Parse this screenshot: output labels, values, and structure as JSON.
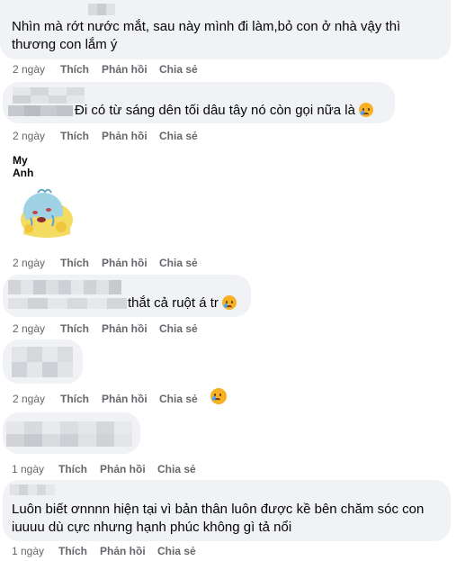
{
  "actions": {
    "time_2d": "2 ngày",
    "time_1d": "1 ngày",
    "like": "Thích",
    "reply": "Phản hồi",
    "share": "Chia sẻ"
  },
  "comments": [
    {
      "text_line1": "Nhìn mà rớt nước mắt, sau này mình đi làm,bỏ con ở nhà vậy thì",
      "text_line2": "thương con lắm ý"
    },
    {
      "text": "Đi có từ sáng dên tối dâu tây nó còn gọi nữa là",
      "emoji": "crying-face-icon"
    },
    {
      "author": "My Anh",
      "sticker": "crying-blob-sticker"
    },
    {
      "text": "thắt cả ruột á tr",
      "emoji": "loudly-crying-face-icon"
    },
    {
      "reaction": "crying-face-icon"
    },
    {},
    {
      "text_line1": "Luôn biết ơnnnn hiện tại vì bản thân luôn được kề bên chăm sóc con",
      "text_line2": "iuuuu dù cực nhưng hạnh phúc không gì tả nổi"
    }
  ],
  "colors": {
    "bubble": "#f0f2f5",
    "meta": "#65676b",
    "text": "#050505"
  }
}
